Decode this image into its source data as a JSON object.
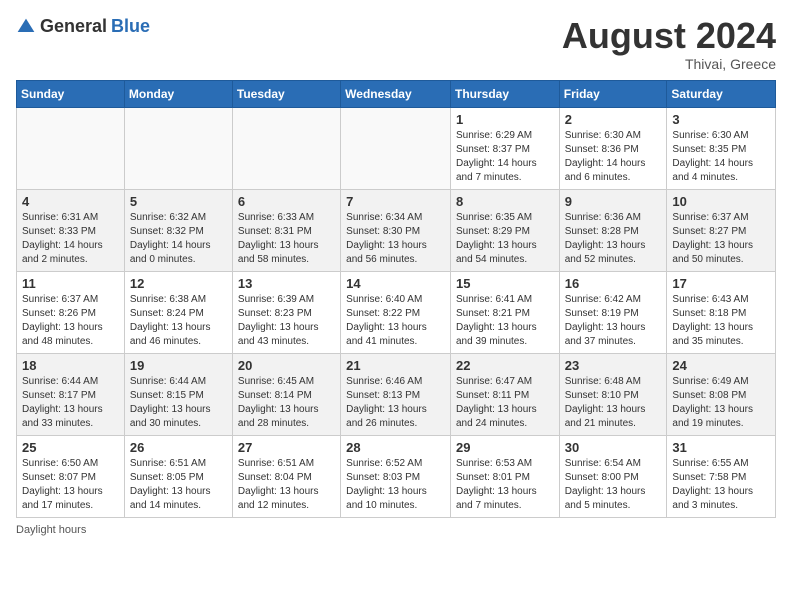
{
  "header": {
    "logo_general": "General",
    "logo_blue": "Blue",
    "month_year": "August 2024",
    "location": "Thivai, Greece"
  },
  "days_of_week": [
    "Sunday",
    "Monday",
    "Tuesday",
    "Wednesday",
    "Thursday",
    "Friday",
    "Saturday"
  ],
  "footer": {
    "daylight_label": "Daylight hours"
  },
  "weeks": [
    {
      "days": [
        {
          "num": "",
          "info": ""
        },
        {
          "num": "",
          "info": ""
        },
        {
          "num": "",
          "info": ""
        },
        {
          "num": "",
          "info": ""
        },
        {
          "num": "1",
          "info": "Sunrise: 6:29 AM\nSunset: 8:37 PM\nDaylight: 14 hours\nand 7 minutes."
        },
        {
          "num": "2",
          "info": "Sunrise: 6:30 AM\nSunset: 8:36 PM\nDaylight: 14 hours\nand 6 minutes."
        },
        {
          "num": "3",
          "info": "Sunrise: 6:30 AM\nSunset: 8:35 PM\nDaylight: 14 hours\nand 4 minutes."
        }
      ]
    },
    {
      "days": [
        {
          "num": "4",
          "info": "Sunrise: 6:31 AM\nSunset: 8:33 PM\nDaylight: 14 hours\nand 2 minutes."
        },
        {
          "num": "5",
          "info": "Sunrise: 6:32 AM\nSunset: 8:32 PM\nDaylight: 14 hours\nand 0 minutes."
        },
        {
          "num": "6",
          "info": "Sunrise: 6:33 AM\nSunset: 8:31 PM\nDaylight: 13 hours\nand 58 minutes."
        },
        {
          "num": "7",
          "info": "Sunrise: 6:34 AM\nSunset: 8:30 PM\nDaylight: 13 hours\nand 56 minutes."
        },
        {
          "num": "8",
          "info": "Sunrise: 6:35 AM\nSunset: 8:29 PM\nDaylight: 13 hours\nand 54 minutes."
        },
        {
          "num": "9",
          "info": "Sunrise: 6:36 AM\nSunset: 8:28 PM\nDaylight: 13 hours\nand 52 minutes."
        },
        {
          "num": "10",
          "info": "Sunrise: 6:37 AM\nSunset: 8:27 PM\nDaylight: 13 hours\nand 50 minutes."
        }
      ]
    },
    {
      "days": [
        {
          "num": "11",
          "info": "Sunrise: 6:37 AM\nSunset: 8:26 PM\nDaylight: 13 hours\nand 48 minutes."
        },
        {
          "num": "12",
          "info": "Sunrise: 6:38 AM\nSunset: 8:24 PM\nDaylight: 13 hours\nand 46 minutes."
        },
        {
          "num": "13",
          "info": "Sunrise: 6:39 AM\nSunset: 8:23 PM\nDaylight: 13 hours\nand 43 minutes."
        },
        {
          "num": "14",
          "info": "Sunrise: 6:40 AM\nSunset: 8:22 PM\nDaylight: 13 hours\nand 41 minutes."
        },
        {
          "num": "15",
          "info": "Sunrise: 6:41 AM\nSunset: 8:21 PM\nDaylight: 13 hours\nand 39 minutes."
        },
        {
          "num": "16",
          "info": "Sunrise: 6:42 AM\nSunset: 8:19 PM\nDaylight: 13 hours\nand 37 minutes."
        },
        {
          "num": "17",
          "info": "Sunrise: 6:43 AM\nSunset: 8:18 PM\nDaylight: 13 hours\nand 35 minutes."
        }
      ]
    },
    {
      "days": [
        {
          "num": "18",
          "info": "Sunrise: 6:44 AM\nSunset: 8:17 PM\nDaylight: 13 hours\nand 33 minutes."
        },
        {
          "num": "19",
          "info": "Sunrise: 6:44 AM\nSunset: 8:15 PM\nDaylight: 13 hours\nand 30 minutes."
        },
        {
          "num": "20",
          "info": "Sunrise: 6:45 AM\nSunset: 8:14 PM\nDaylight: 13 hours\nand 28 minutes."
        },
        {
          "num": "21",
          "info": "Sunrise: 6:46 AM\nSunset: 8:13 PM\nDaylight: 13 hours\nand 26 minutes."
        },
        {
          "num": "22",
          "info": "Sunrise: 6:47 AM\nSunset: 8:11 PM\nDaylight: 13 hours\nand 24 minutes."
        },
        {
          "num": "23",
          "info": "Sunrise: 6:48 AM\nSunset: 8:10 PM\nDaylight: 13 hours\nand 21 minutes."
        },
        {
          "num": "24",
          "info": "Sunrise: 6:49 AM\nSunset: 8:08 PM\nDaylight: 13 hours\nand 19 minutes."
        }
      ]
    },
    {
      "days": [
        {
          "num": "25",
          "info": "Sunrise: 6:50 AM\nSunset: 8:07 PM\nDaylight: 13 hours\nand 17 minutes."
        },
        {
          "num": "26",
          "info": "Sunrise: 6:51 AM\nSunset: 8:05 PM\nDaylight: 13 hours\nand 14 minutes."
        },
        {
          "num": "27",
          "info": "Sunrise: 6:51 AM\nSunset: 8:04 PM\nDaylight: 13 hours\nand 12 minutes."
        },
        {
          "num": "28",
          "info": "Sunrise: 6:52 AM\nSunset: 8:03 PM\nDaylight: 13 hours\nand 10 minutes."
        },
        {
          "num": "29",
          "info": "Sunrise: 6:53 AM\nSunset: 8:01 PM\nDaylight: 13 hours\nand 7 minutes."
        },
        {
          "num": "30",
          "info": "Sunrise: 6:54 AM\nSunset: 8:00 PM\nDaylight: 13 hours\nand 5 minutes."
        },
        {
          "num": "31",
          "info": "Sunrise: 6:55 AM\nSunset: 7:58 PM\nDaylight: 13 hours\nand 3 minutes."
        }
      ]
    }
  ]
}
